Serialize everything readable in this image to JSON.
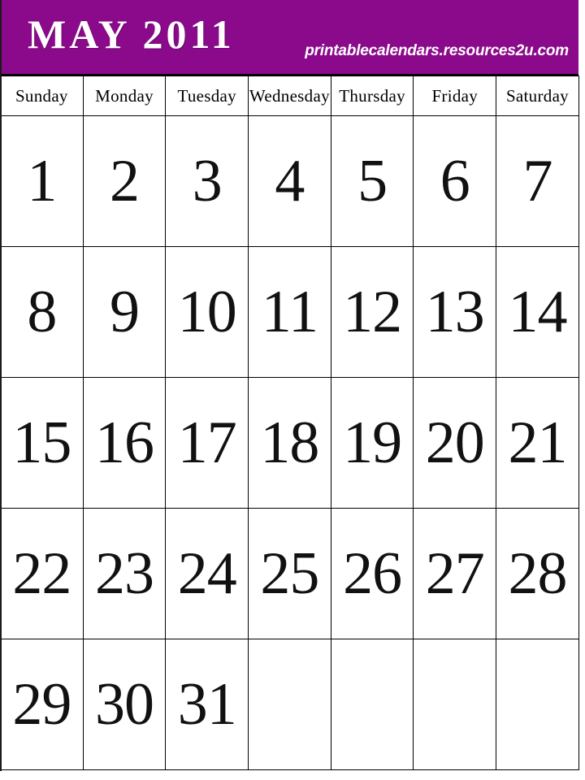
{
  "header": {
    "title": "MAY 2011",
    "url": "printablecalendars.resources2u.com",
    "background_color": "#8B0A8B",
    "text_color": "#FFFFFF"
  },
  "calendar": {
    "month": "MAY",
    "year": "2011",
    "weekday_headers": [
      "Sunday",
      "Monday",
      "Tuesday",
      "Wednesday",
      "Thursday",
      "Friday",
      "Saturday"
    ],
    "weeks": [
      {
        "days": [
          "1",
          "2",
          "3",
          "4",
          "5",
          "6",
          "7"
        ]
      },
      {
        "days": [
          "8",
          "9",
          "10",
          "11",
          "12",
          "13",
          "14"
        ]
      },
      {
        "days": [
          "15",
          "16",
          "17",
          "18",
          "19",
          "20",
          "21"
        ]
      },
      {
        "days": [
          "22",
          "23",
          "24",
          "25",
          "26",
          "27",
          "28"
        ]
      },
      {
        "days": [
          "29",
          "30",
          "31",
          "",
          "",
          "",
          ""
        ]
      }
    ]
  },
  "style": {
    "grid_line_color": "#000000",
    "cell_background": "#FFFFFF",
    "day_number_color": "#111111"
  }
}
